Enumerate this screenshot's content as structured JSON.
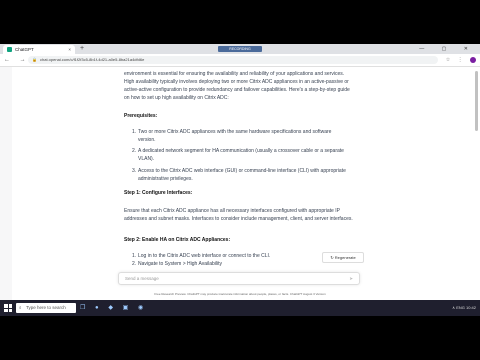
{
  "browser": {
    "tab_title": "ChatGPT",
    "tab_close": "×",
    "new_tab": "+",
    "recording_label": "RECORDING",
    "url": "chat.openai.com/c/f1f2f3c5-8b1f-4d21-a0e5-8ba21a4dfd6e",
    "nav_icons": "← → ⟳",
    "window_controls": "— ▢ ✕"
  },
  "content": {
    "intro": "environment is essential for ensuring the availability and reliability of your applications and services. High availability typically involves deploying two or more Citrix ADC appliances in an active-passive or active-active configuration to provide redundancy and failover capabilities. Here's a step-by-step guide on how to set up high availability on Citrix ADC:",
    "prereq_heading": "Prerequisites:",
    "prereqs": [
      {
        "n": "1.",
        "text": "Two or more Citrix ADC appliances with the same hardware specifications and software version."
      },
      {
        "n": "2.",
        "text": "A dedicated network segment for HA communication (usually a crossover cable or a separate VLAN)."
      },
      {
        "n": "3.",
        "text": "Access to the Citrix ADC web interface (GUI) or command-line interface (CLI) with appropriate administrative privileges."
      }
    ],
    "step1_heading": "Step 1: Configure Interfaces:",
    "step1_text": "Ensure that each Citrix ADC appliance has all necessary interfaces configured with appropriate IP addresses and subnet masks. Interfaces to consider include management, client, and server interfaces.",
    "step2_heading": "Step 2: Enable HA on Citrix ADC Appliances:",
    "step2_items": [
      {
        "n": "1.",
        "text": "Log in to the Citrix ADC web interface or connect to the CLI."
      },
      {
        "n": "2.",
        "text": "Navigate to System > High Availability"
      }
    ],
    "regenerate_label": "↻ Regenerate",
    "input_placeholder": "Send a message",
    "footer_text": "Free Research Preview. ChatGPT may produce inaccurate information about people, places, or facts. ChatGPT August 3 Version"
  },
  "taskbar": {
    "search_placeholder": "Type here to search",
    "icons": "❐ ● ◆ ▣ ◉",
    "tray": "∧ ENG 10:42"
  }
}
